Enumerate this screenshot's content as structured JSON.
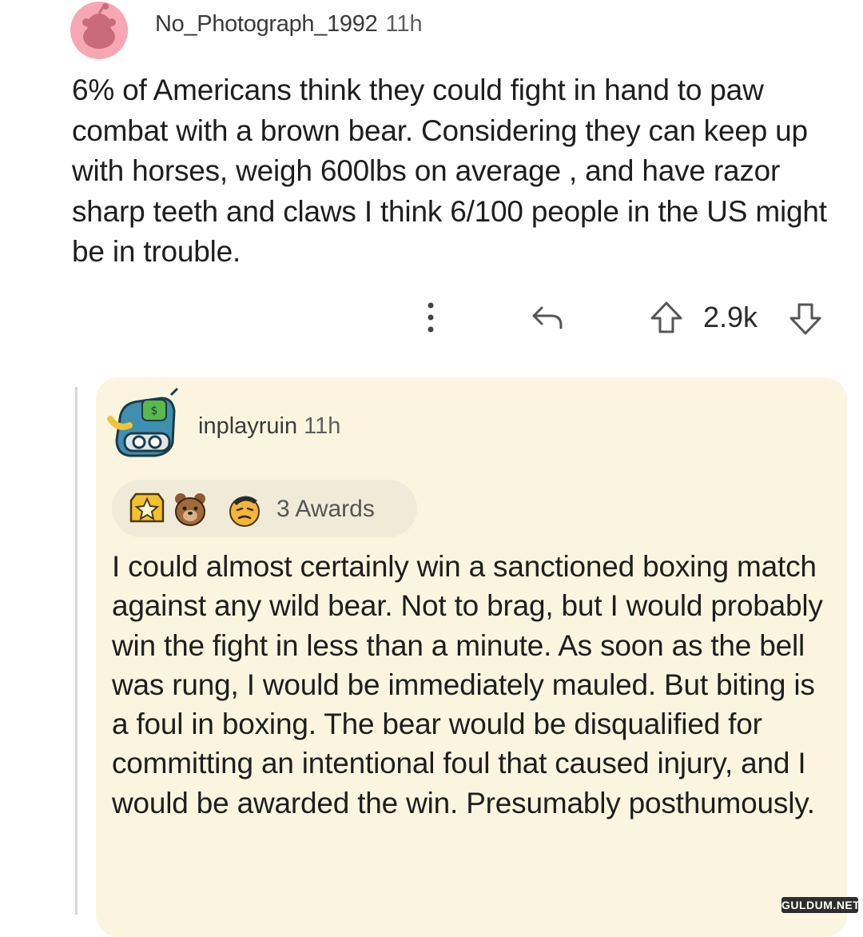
{
  "comment": {
    "username": "No_Photograph_1992",
    "age": "11h",
    "body": "6% of Americans think they could fight in hand to paw combat with a brown bear. Considering they can keep up with horses, weigh 600lbs on average , and have razor sharp teeth and claws I think 6/100 people in the US might be in trouble.",
    "score": "2.9k",
    "avatar_color": "#f7a7b3"
  },
  "reply": {
    "username": "inplayruin",
    "age": "11h",
    "awards_label": "3 Awards",
    "body": "I could almost certainly win a sanctioned boxing match against any wild bear. Not to brag, but I would probably win the fight in less than a minute. As soon as the bell was rung, I would be immediately mauled. But biting is a foul in boxing. The bear would be disqualified for committing an intentional foul that caused injury, and I would be awarded the win. Presumably posthumously.",
    "card_color": "#fbf5e0"
  },
  "watermark": "GULDUM.NET"
}
